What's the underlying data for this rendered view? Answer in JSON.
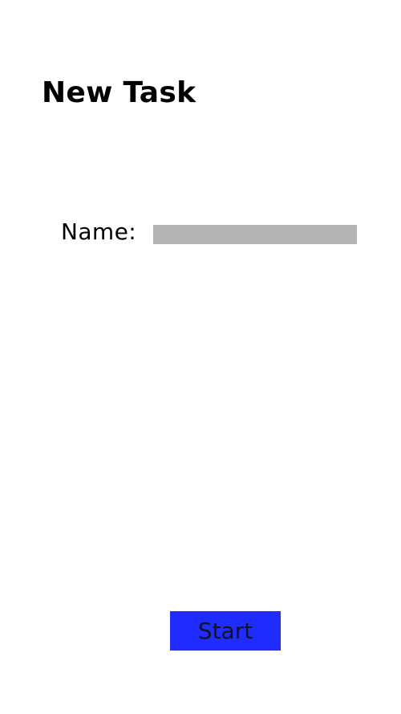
{
  "page": {
    "title": "New Task"
  },
  "form": {
    "name_label": "Name:",
    "name_value": "",
    "name_placeholder": ""
  },
  "actions": {
    "start_label": "Start"
  },
  "colors": {
    "background": "#ffffff",
    "input_fill": "#b3b3b3",
    "start_button": "#1f2cff",
    "text": "#000000"
  }
}
